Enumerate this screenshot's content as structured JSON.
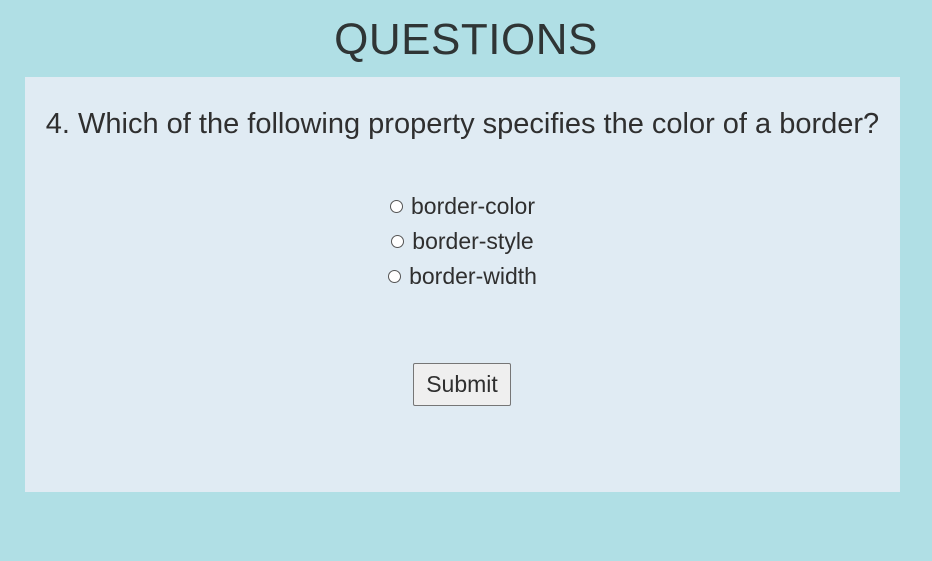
{
  "page": {
    "title": "QUESTIONS",
    "background_color": "#b0dfe5",
    "card_color": "#e0ebf3"
  },
  "quiz": {
    "question": "4. Which of the following property specifies the color of a border?",
    "options": [
      {
        "label": "border-color",
        "selected": false
      },
      {
        "label": "border-style",
        "selected": false
      },
      {
        "label": "border-width",
        "selected": false
      }
    ],
    "submit_label": "Submit"
  }
}
